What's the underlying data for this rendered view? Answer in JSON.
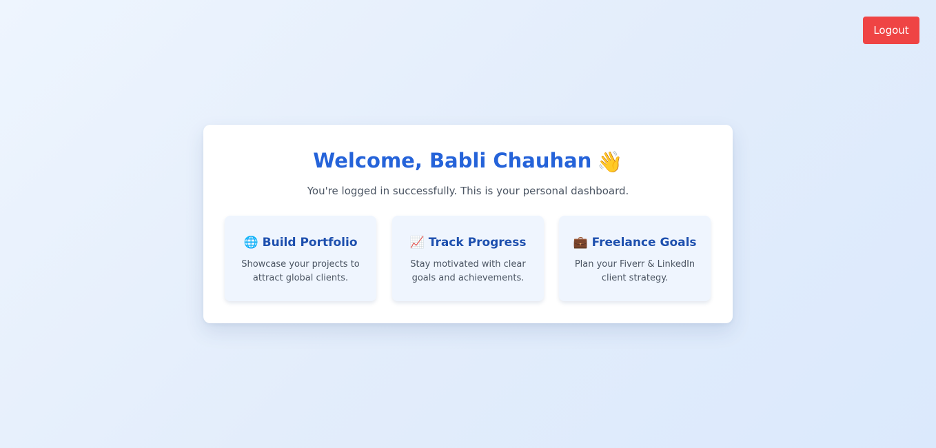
{
  "header": {
    "logout_label": "Logout"
  },
  "welcome": {
    "title": "Welcome, Babli Chauhan",
    "wave_icon": "👋",
    "subtitle": "You're logged in successfully. This is your personal dashboard."
  },
  "features": [
    {
      "icon": "🌐",
      "icon_name": "globe-icon",
      "title": "Build Portfolio",
      "description": "Showcase your projects to attract global clients."
    },
    {
      "icon": "📈",
      "icon_name": "chart-increasing-icon",
      "title": "Track Progress",
      "description": "Stay motivated with clear goals and achievements."
    },
    {
      "icon": "💼",
      "icon_name": "briefcase-icon",
      "title": "Freelance Goals",
      "description": "Plan your Fiverr & LinkedIn client strategy."
    }
  ],
  "colors": {
    "accent": "#2563d9",
    "logout": "#ef4444",
    "feature_bg": "#eff5fe",
    "feature_title": "#1d4fae"
  }
}
